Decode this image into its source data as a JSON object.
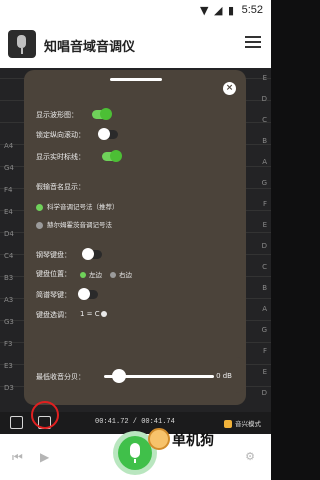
{
  "status_bar": {
    "time": "5:52",
    "icons": [
      "wifi-icon",
      "signal-icon",
      "battery-icon"
    ]
  },
  "app_bar": {
    "title": "知唱音域音调仪",
    "menu_icon": "menu-icon"
  },
  "piano_roll": {
    "left_notes": [
      "A4",
      "G4",
      "F4",
      "E4",
      "D4",
      "C4",
      "B3",
      "A3",
      "G3",
      "F3",
      "E3",
      "D3"
    ],
    "right_notes": [
      "E",
      "D",
      "C",
      "B",
      "A",
      "G",
      "F",
      "E",
      "D",
      "C",
      "B",
      "A",
      "G",
      "F",
      "E",
      "D"
    ]
  },
  "settings_panel": {
    "show_waveform_label": "显示波形图：",
    "show_waveform_on": true,
    "lock_scroll_label": "锁定纵向滚动：",
    "lock_scroll_on": false,
    "show_realtime_line_label": "显示实时标线：",
    "show_realtime_line_on": true,
    "pitch_notation_label": "假输音名显示：",
    "pitch_notation_options": [
      {
        "label": "科学音调记号法（推荐）",
        "selected": true
      },
      {
        "label": "赫尔姆霍茨音调记号法",
        "selected": false
      }
    ],
    "piano_keyboard_label": "钢琴键盘：",
    "piano_keyboard_on": false,
    "keyboard_position_label": "键盘位置：",
    "keyboard_position_options": [
      {
        "label": "左边",
        "selected": true
      },
      {
        "label": "右边",
        "selected": false
      }
    ],
    "simple_keyboard_label": "简谱琴键：",
    "simple_keyboard_on": false,
    "key_select_label": "键盘选调：",
    "key_select_value": "1 = C"
  },
  "volume_panel": {
    "label": "最低收音分贝：",
    "value_text": "0 dB",
    "value_fraction": 0.0
  },
  "bottom_bar": {
    "time_text": "00:41.72 / 00:41.74",
    "right_text": "音兴模式"
  },
  "controls": {
    "prev_icon": "prev-icon",
    "play_icon": "play-icon",
    "record_icon": "microphone-icon",
    "settings_icon": "sliders-icon"
  },
  "watermark": {
    "text": "单机狗"
  },
  "colors": {
    "panel_bg": "#4b433a",
    "accent_green": "#6fd25a",
    "highlight_red": "#e02020"
  }
}
